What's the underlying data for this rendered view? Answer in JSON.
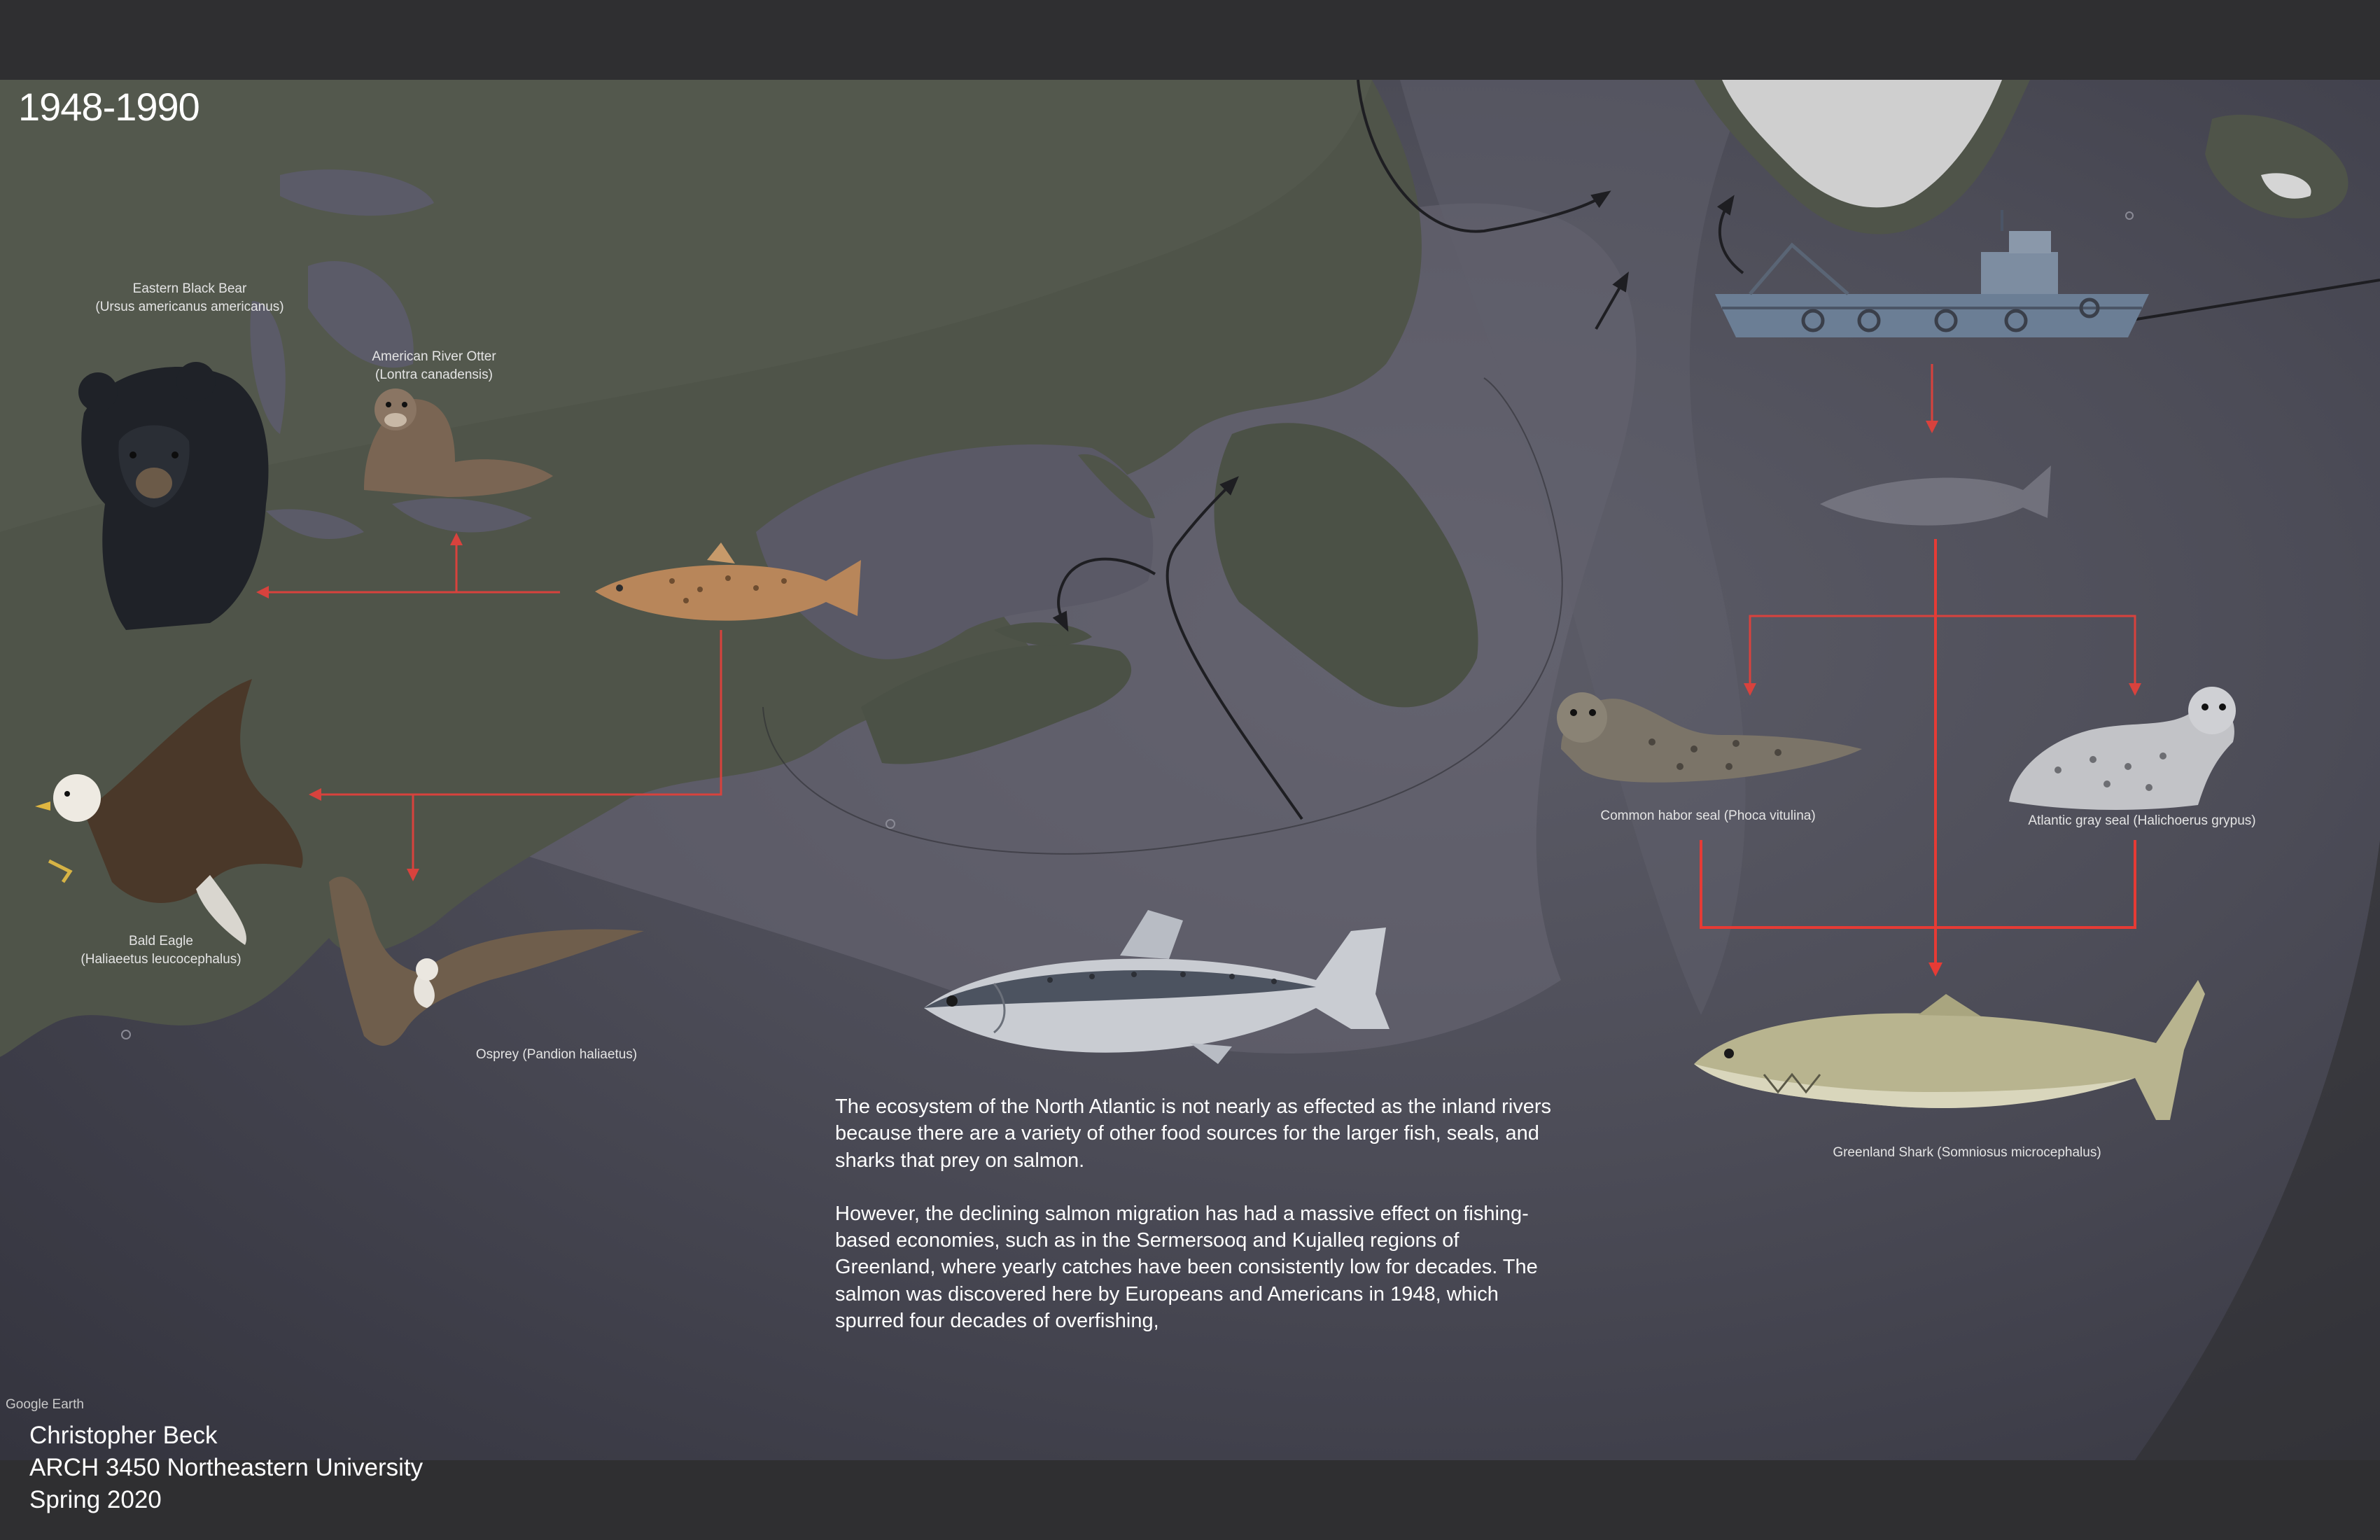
{
  "title": "1948-1990",
  "credits": {
    "google_earth": "Google Earth",
    "author": "Christopher Beck",
    "course": "ARCH 3450 Northeastern University",
    "term": "Spring 2020"
  },
  "species": {
    "black_bear": {
      "common": "Eastern Black Bear",
      "latin": "(Ursus americanus americanus)"
    },
    "river_otter": {
      "common": "American River Otter",
      "latin": "(Lontra canadensis)"
    },
    "bald_eagle": {
      "common": "Bald Eagle",
      "latin": "(Haliaeetus leucocephalus)"
    },
    "osprey": {
      "label": "Osprey (Pandion haliaetus)"
    },
    "harbor_seal": {
      "label": "Common habor seal (Phoca vitulina)"
    },
    "gray_seal": {
      "label": "Atlantic gray seal (Halichoerus grypus)"
    },
    "greenland_shark": {
      "label": "Greenland Shark (Somniosus microcephalus)"
    }
  },
  "description": {
    "paragraph_1": "The ecosystem of the North Atlantic is not nearly as effected as the inland rivers because there are a variety of other food sources for the larger fish, seals, and sharks that prey on salmon.",
    "paragraph_2": "However, the declining salmon migration has had a massive effect on fishing-based economies, such as in the Sermersooq and Kujalleq regions of Greenland, where yearly catches have been consistently low for decades. The salmon was discovered here by Europeans and Americans in 1948, which spurred four decades of overfishing,"
  },
  "colors": {
    "food_web_arrow": "#d8423d",
    "migration_arrow": "#1e1e22",
    "land": "#4f5449",
    "greenland_ice": "#c9c9c9",
    "ocean_deep": "#3c3c47"
  }
}
